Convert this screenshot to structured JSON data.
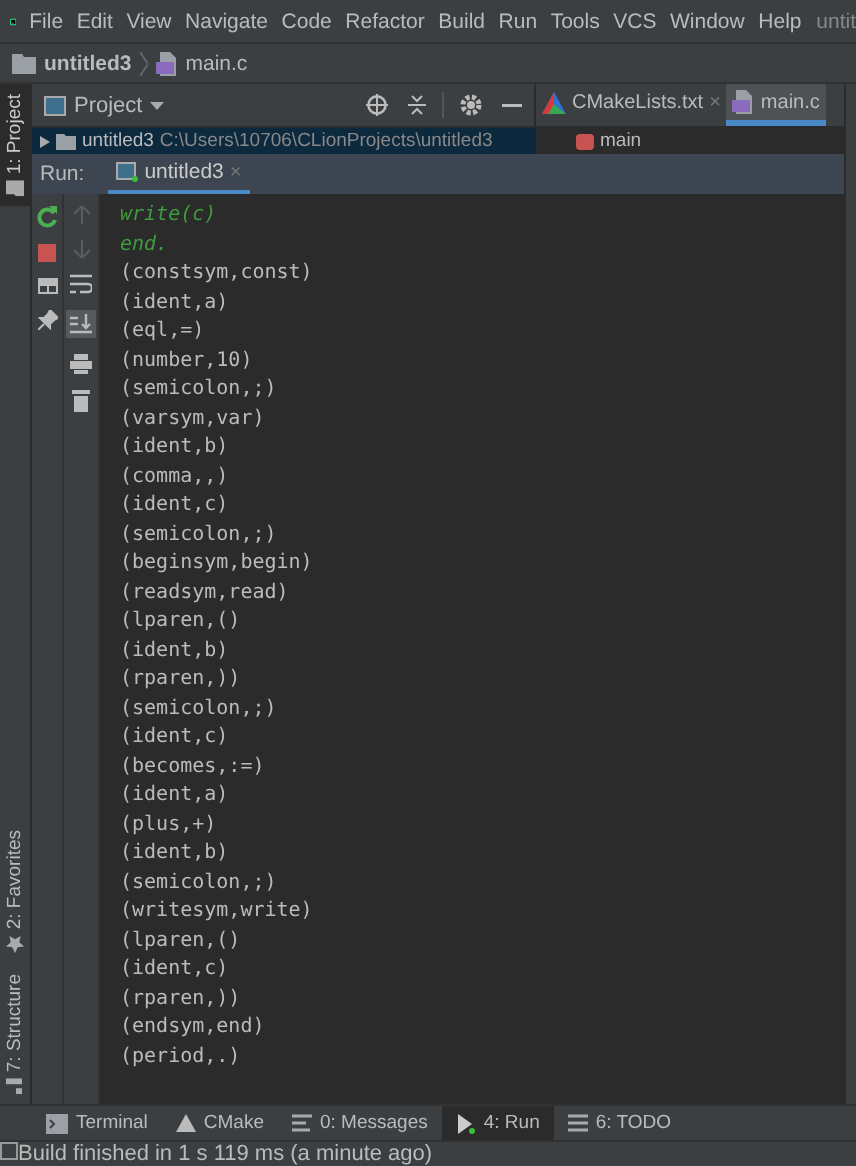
{
  "menu": {
    "items": [
      "File",
      "Edit",
      "View",
      "Navigate",
      "Code",
      "Refactor",
      "Build",
      "Run",
      "Tools",
      "VCS",
      "Window",
      "Help"
    ],
    "title": "untit"
  },
  "breadcrumb": [
    "untitled3",
    "main.c"
  ],
  "project_panel": {
    "title": "Project",
    "tree_row": {
      "name": "untitled3",
      "path": "C:\\Users\\10706\\CLionProjects\\untitled3"
    }
  },
  "editor": {
    "tabs": [
      {
        "label": "CMakeLists.txt",
        "kind": "cmake",
        "selected": false,
        "close": "×"
      },
      {
        "label": "main.c",
        "kind": "c",
        "selected": true
      }
    ],
    "structure_item": "main"
  },
  "side_tabs": {
    "top": [
      {
        "label": "1: Project",
        "selected": true
      }
    ],
    "bottom": [
      {
        "label": "2: Favorites",
        "selected": false
      },
      {
        "label": "7: Structure",
        "selected": false
      }
    ]
  },
  "run": {
    "label": "Run:",
    "tab": "untitled3",
    "tab_close": "×",
    "lines": [
      {
        "text": "write(c)",
        "kind": "echo"
      },
      {
        "text": "end.",
        "kind": "echo"
      },
      {
        "text": "(constsym,const)",
        "kind": "out"
      },
      {
        "text": "(ident,a)",
        "kind": "out"
      },
      {
        "text": "(eql,=)",
        "kind": "out"
      },
      {
        "text": "(number,10)",
        "kind": "out"
      },
      {
        "text": "(semicolon,;)",
        "kind": "out"
      },
      {
        "text": "(varsym,var)",
        "kind": "out"
      },
      {
        "text": "(ident,b)",
        "kind": "out"
      },
      {
        "text": "(comma,,)",
        "kind": "out"
      },
      {
        "text": "(ident,c)",
        "kind": "out"
      },
      {
        "text": "(semicolon,;)",
        "kind": "out"
      },
      {
        "text": "(beginsym,begin)",
        "kind": "out"
      },
      {
        "text": "(readsym,read)",
        "kind": "out"
      },
      {
        "text": "(lparen,()",
        "kind": "out"
      },
      {
        "text": "(ident,b)",
        "kind": "out"
      },
      {
        "text": "(rparen,))",
        "kind": "out"
      },
      {
        "text": "(semicolon,;)",
        "kind": "out"
      },
      {
        "text": "(ident,c)",
        "kind": "out"
      },
      {
        "text": "(becomes,:=)",
        "kind": "out"
      },
      {
        "text": "(ident,a)",
        "kind": "out"
      },
      {
        "text": "(plus,+)",
        "kind": "out"
      },
      {
        "text": "(ident,b)",
        "kind": "out"
      },
      {
        "text": "(semicolon,;)",
        "kind": "out"
      },
      {
        "text": "(writesym,write)",
        "kind": "out"
      },
      {
        "text": "(lparen,()",
        "kind": "out"
      },
      {
        "text": "(ident,c)",
        "kind": "out"
      },
      {
        "text": "(rparen,))",
        "kind": "out"
      },
      {
        "text": "(endsym,end)",
        "kind": "out"
      },
      {
        "text": "(period,.)",
        "kind": "out"
      }
    ]
  },
  "bottom_tabs": [
    {
      "label": "Terminal",
      "kind": "terminal",
      "selected": false
    },
    {
      "label": "CMake",
      "kind": "cmake",
      "selected": false
    },
    {
      "label": "0: Messages",
      "kind": "messages",
      "selected": false
    },
    {
      "label": "4: Run",
      "kind": "run",
      "selected": true
    },
    {
      "label": "6: TODO",
      "kind": "todo",
      "selected": false
    }
  ],
  "status_bar": "Build finished in 1 s 119 ms (a minute ago)"
}
